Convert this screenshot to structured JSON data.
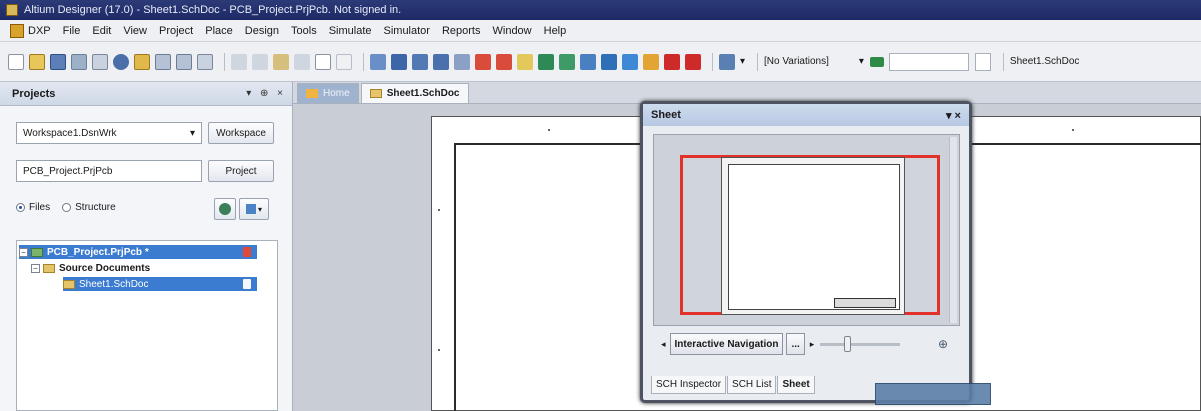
{
  "window": {
    "title": "Altium Designer (17.0) - Sheet1.SchDoc - PCB_Project.PrjPcb. Not signed in."
  },
  "menu": {
    "items": [
      "DXP",
      "File",
      "Edit",
      "View",
      "Project",
      "Place",
      "Design",
      "Tools",
      "Simulate",
      "Simulator",
      "Reports",
      "Window",
      "Help"
    ]
  },
  "toolbar": {
    "variations_label": "[No Variations]",
    "sheet_combo": "Sheet1.SchDoc"
  },
  "projects_panel": {
    "title": "Projects",
    "controls": "▾ ⊕ ×",
    "workspace_combo": "Workspace1.DsnWrk",
    "workspace_button": "Workspace",
    "project_field": "PCB_Project.PrjPcb",
    "project_button": "Project",
    "radio_files": "Files",
    "radio_structure": "Structure",
    "tree": {
      "project": "PCB_Project.PrjPcb *",
      "folder": "Source Documents",
      "document": "Sheet1.SchDoc"
    }
  },
  "doc_tabs": {
    "home": "Home",
    "active": "Sheet1.SchDoc"
  },
  "sheet_panel": {
    "title": "Sheet",
    "controls": "▾ ×",
    "nav_button": "Interactive Navigation",
    "nav_more": "...",
    "tabs": [
      "SCH Inspector",
      "SCH List",
      "Sheet"
    ]
  },
  "colors": {
    "title_bar": "#1d2a66",
    "selection": "#3b7bd0",
    "view_box": "#e1312a"
  }
}
